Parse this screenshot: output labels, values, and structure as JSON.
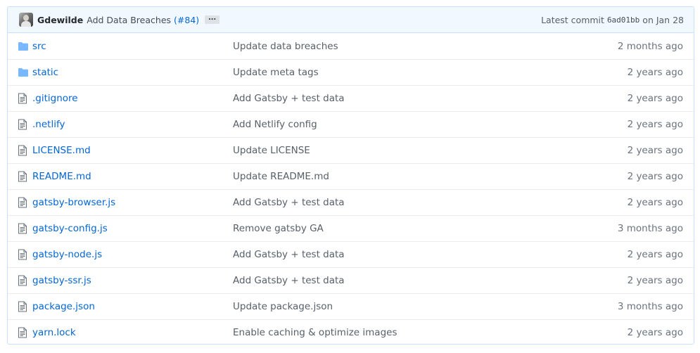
{
  "commit": {
    "author": "Gdewilde",
    "message": "Add Data Breaches",
    "pr": "(#84)",
    "ellipsis": "…",
    "latest_label": "Latest commit",
    "sha": "6ad01bb",
    "date": "on Jan 28"
  },
  "files": [
    {
      "name": "src",
      "type": "dir",
      "icon": "folder-icon",
      "message": "Update data breaches",
      "age": "2 months ago"
    },
    {
      "name": "static",
      "type": "dir",
      "icon": "folder-icon",
      "message": "Update meta tags",
      "age": "2 years ago"
    },
    {
      "name": ".gitignore",
      "type": "file",
      "icon": "file-icon",
      "message": "Add Gatsby + test data",
      "age": "2 years ago"
    },
    {
      "name": ".netlify",
      "type": "file",
      "icon": "file-icon",
      "message": "Add Netlify config",
      "age": "2 years ago"
    },
    {
      "name": "LICENSE.md",
      "type": "file",
      "icon": "file-icon",
      "message": "Update LICENSE",
      "age": "2 years ago"
    },
    {
      "name": "README.md",
      "type": "file",
      "icon": "file-icon",
      "message": "Update README.md",
      "age": "2 years ago"
    },
    {
      "name": "gatsby-browser.js",
      "type": "file",
      "icon": "file-icon",
      "message": "Add Gatsby + test data",
      "age": "2 years ago"
    },
    {
      "name": "gatsby-config.js",
      "type": "file",
      "icon": "file-icon",
      "message": "Remove gatsby GA",
      "age": "3 months ago"
    },
    {
      "name": "gatsby-node.js",
      "type": "file",
      "icon": "file-icon",
      "message": "Add Gatsby + test data",
      "age": "2 years ago"
    },
    {
      "name": "gatsby-ssr.js",
      "type": "file",
      "icon": "file-icon",
      "message": "Add Gatsby + test data",
      "age": "2 years ago"
    },
    {
      "name": "package.json",
      "type": "file",
      "icon": "file-icon",
      "message": "Update package.json",
      "age": "3 months ago"
    },
    {
      "name": "yarn.lock",
      "type": "file",
      "icon": "file-icon",
      "message": "Enable caching & optimize images",
      "age": "2 years ago"
    }
  ],
  "colors": {
    "link": "#0366d6",
    "icon": "#79b8ff",
    "header_bg": "#f1f8ff",
    "border": "#c8e1ff"
  }
}
